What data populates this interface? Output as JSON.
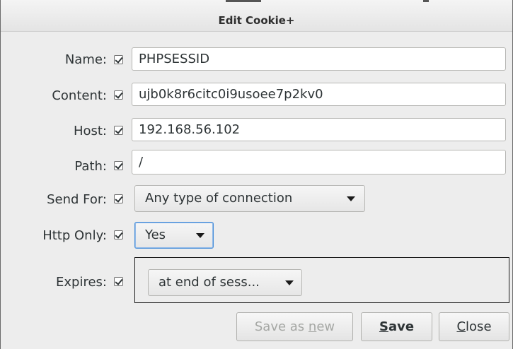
{
  "window": {
    "title": "Edit Cookie+"
  },
  "fields": {
    "name": {
      "label": "Name:",
      "value": "PHPSESSID",
      "checked": true
    },
    "content": {
      "label": "Content:",
      "value": "ujb0k8r6citc0i9usoee7p2kv0",
      "checked": true
    },
    "host": {
      "label": "Host:",
      "value": "192.168.56.102",
      "checked": true
    },
    "path": {
      "label": "Path:",
      "value": "/",
      "checked": true
    },
    "send_for": {
      "label": "Send For:",
      "value": "Any type of connection",
      "checked": true
    },
    "http_only": {
      "label": "Http Only:",
      "value": "Yes",
      "checked": true
    },
    "expires": {
      "label": "Expires:",
      "value": "at end of sess...",
      "checked": true
    }
  },
  "buttons": {
    "save_as_new": {
      "pre": "Save as ",
      "mnemonic": "n",
      "post": "ew",
      "enabled": false
    },
    "save": {
      "mnemonic": "S",
      "post": "ave"
    },
    "close": {
      "mnemonic": "C",
      "post": "lose"
    }
  },
  "colors": {
    "focus_border": "#4a90d9",
    "disabled_text": "#a5a7a4"
  }
}
